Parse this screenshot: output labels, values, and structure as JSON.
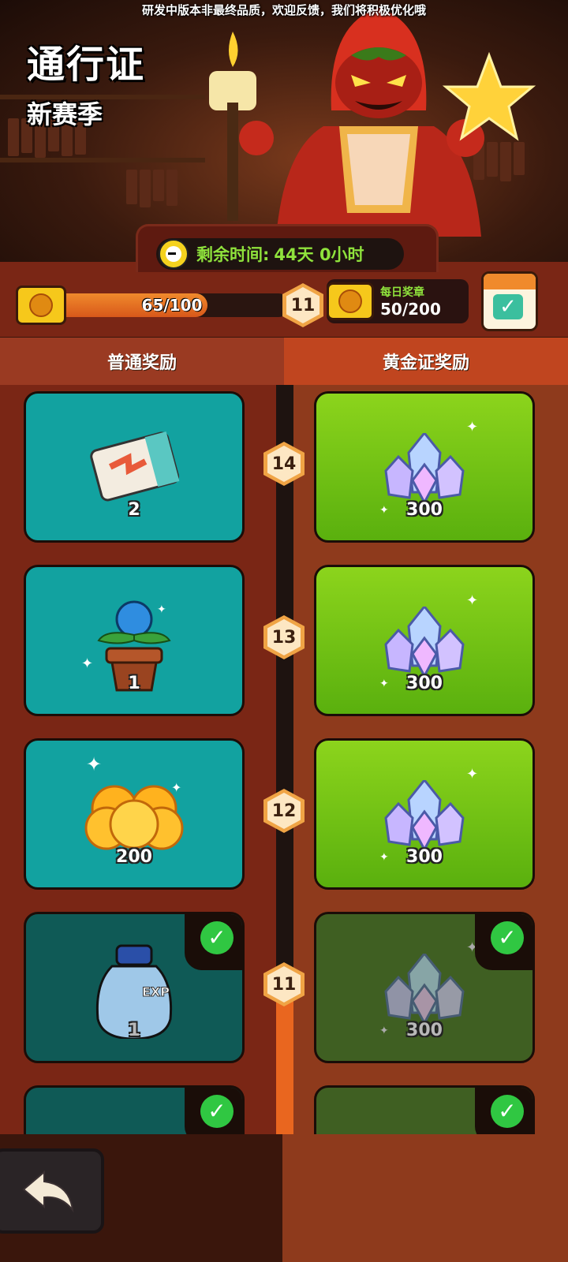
{
  "notice": "研发中版本非最终品质，欢迎反馈，我们将积极优化哦",
  "header": {
    "title": "通行证",
    "subtitle": "新赛季",
    "timer_label": "剩余时间:",
    "timer_value": "44天 0小时"
  },
  "progress": {
    "text": "65/100",
    "fraction": 0.65,
    "level": "11"
  },
  "daily": {
    "label": "每日奖章",
    "value": "50/200"
  },
  "tabs": {
    "normal": "普通奖励",
    "gold": "黄金证奖励"
  },
  "rewards": [
    {
      "level": "14",
      "normal_icon": "ticket-icon",
      "normal_qty": "2",
      "gold_icon": "crystal-icon",
      "gold_qty": "300",
      "claimed": false
    },
    {
      "level": "13",
      "normal_icon": "potted-plant-icon",
      "normal_qty": "1",
      "gold_icon": "crystal-icon",
      "gold_qty": "300",
      "claimed": false
    },
    {
      "level": "12",
      "normal_icon": "gold-coins-icon",
      "normal_qty": "200",
      "gold_icon": "crystal-icon",
      "gold_qty": "300",
      "claimed": false
    },
    {
      "level": "11",
      "normal_icon": "exp-bottle-icon",
      "normal_qty": "1",
      "gold_icon": "crystal-icon",
      "gold_qty": "300",
      "claimed": true
    },
    {
      "level": "",
      "normal_icon": "",
      "normal_qty": "",
      "gold_icon": "",
      "gold_qty": "",
      "claimed": true
    }
  ],
  "colors": {
    "teal_card": "#12a2a0",
    "green_card": "#7cc418",
    "accent_green_text": "#8fe23c",
    "progress_orange": "#e9661f",
    "check_green": "#30c742"
  }
}
